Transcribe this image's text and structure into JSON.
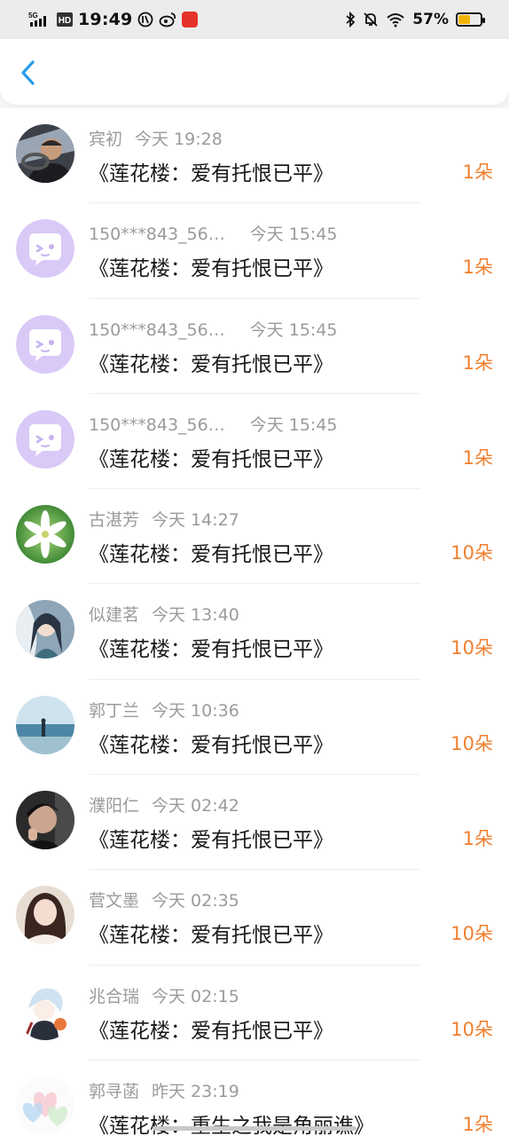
{
  "status_bar": {
    "network": "5G",
    "hd": "HD",
    "time": "19:49",
    "battery": "57%",
    "battery_level": 0.57
  },
  "header": {
    "back_icon": "chevron-left-icon",
    "accent_color": "#2a9be8"
  },
  "colors": {
    "count": "#f07f2e",
    "meta": "#9b9b9b",
    "title": "#1a1a1a",
    "default_avatar_bg": "#d6c6f5"
  },
  "rows": [
    {
      "name": "宾初",
      "time": "今天 19:28",
      "title": "《莲花楼：爱有托恨已平》",
      "count": "1朵",
      "avatar": "photo-driver"
    },
    {
      "name": "150***843_56…",
      "time": "今天 15:45",
      "title": "《莲花楼：爱有托恨已平》",
      "count": "1朵",
      "avatar": "default-chat-bubble"
    },
    {
      "name": "150***843_56…",
      "time": "今天 15:45",
      "title": "《莲花楼：爱有托恨已平》",
      "count": "1朵",
      "avatar": "default-chat-bubble"
    },
    {
      "name": "150***843_56…",
      "time": "今天 15:45",
      "title": "《莲花楼：爱有托恨已平》",
      "count": "1朵",
      "avatar": "default-chat-bubble"
    },
    {
      "name": "古湛芳",
      "time": "今天 14:27",
      "title": "《莲花楼：爱有托恨已平》",
      "count": "10朵",
      "avatar": "photo-white-flower"
    },
    {
      "name": "似建茗",
      "time": "今天 13:40",
      "title": "《莲花楼：爱有托恨已平》",
      "count": "10朵",
      "avatar": "photo-anime-character"
    },
    {
      "name": "郭丁兰",
      "time": "今天 10:36",
      "title": "《莲花楼：爱有托恨已平》",
      "count": "10朵",
      "avatar": "photo-beach"
    },
    {
      "name": "濮阳仁",
      "time": "今天 02:42",
      "title": "《莲花楼：爱有托恨已平》",
      "count": "1朵",
      "avatar": "photo-young-man"
    },
    {
      "name": "菅文墨",
      "time": "今天 02:35",
      "title": "《莲花楼：爱有托恨已平》",
      "count": "10朵",
      "avatar": "photo-girl"
    },
    {
      "name": "兆合瑞",
      "time": "今天 02:15",
      "title": "《莲花楼：爱有托恨已平》",
      "count": "10朵",
      "avatar": "photo-anime-boy"
    },
    {
      "name": "郭寻菡",
      "time": "昨天 23:19",
      "title": "《莲花楼：重生之我是角丽谯》",
      "count": "1朵",
      "avatar": "photo-hearts"
    }
  ]
}
